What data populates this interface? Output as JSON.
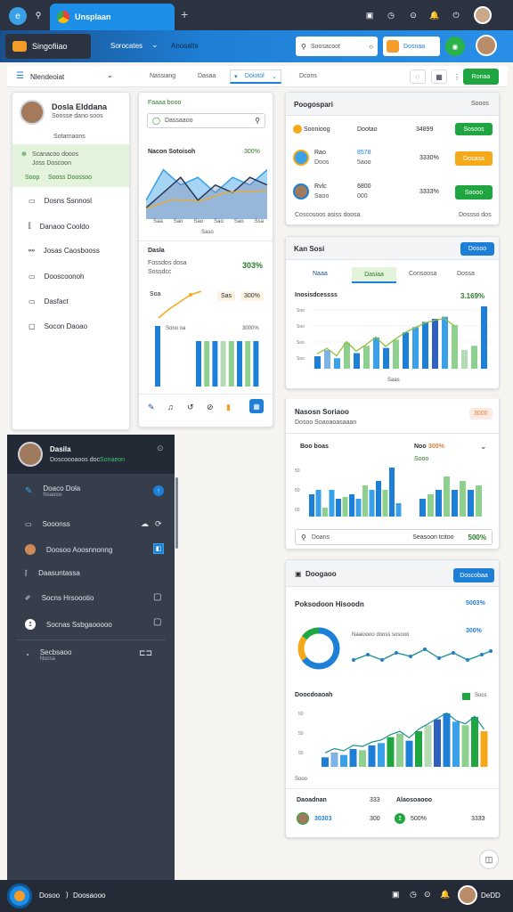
{
  "browser": {
    "tab_title": "Unsplaan",
    "new_tab": "+"
  },
  "appbar": {
    "brand": "Singofiiao",
    "nav1": "Sorocates",
    "nav2": "Anosalts",
    "search_placeholder": "Soosacoot",
    "cta": "Dosnaa"
  },
  "subtoolbar": {
    "menu": "Nlendeoiat",
    "filters": [
      "Nassiang",
      "Dasaa",
      "Doiotol"
    ],
    "right_label": "Dcons",
    "action": "Ronaa"
  },
  "sidebar": {
    "user_name": "Dosla Elddana",
    "user_sub": "Soosse dano soos",
    "section": "Sotarnaons",
    "sel_line1": "Scanacoo dooos",
    "sel_line2": "Joss Doscoon",
    "sel_link_a": "Soop",
    "sel_link_b": "Sooss Doossoo",
    "items": [
      "Dosns Ssnnosl",
      "Danaoo Cooldo",
      "Josas Caosbooss",
      "Dooscoonoh",
      "Dasfact",
      "Socon Daoao"
    ]
  },
  "midcol": {
    "top_label": "Faaaa booo",
    "search_placeholder": "Dassaaoo",
    "chart1": {
      "title": "Nacon Sotoisoh",
      "pct": "300%",
      "ticks": [
        "Saa",
        "Sao",
        "Sao",
        "Sao",
        "Sao",
        "Ssa"
      ],
      "xlabel": "Saso"
    },
    "chart2": {
      "title": "Dasla",
      "sub": "Fossdos dosa",
      "sub2": "Sossdcc",
      "pct": "303%",
      "b1": "Soa",
      "b2": "Sas",
      "b3": "300%"
    },
    "chart3": {
      "legend_left": "Sono oa",
      "legend_right": "3000%"
    }
  },
  "dark": {
    "user_name": "Dasila",
    "user_sub": "Doscoooaoos doc",
    "user_status": "Sonaeon",
    "items": [
      {
        "label": "Doaco Dola",
        "sub": "Nsaooo"
      },
      {
        "label": "Sooonss"
      },
      {
        "label": "Doosoo Aoosnnonng"
      },
      {
        "label": "Daasuntassa"
      },
      {
        "label": "Socns Hrsoootio"
      },
      {
        "label": "Socnas Ssbgaooooo"
      },
      {
        "label": "Secbsaoo",
        "sub": "Nsosa"
      }
    ]
  },
  "panel1": {
    "title": "Poogospari",
    "link": "Sooos",
    "rows": [
      {
        "name": "Soonioog",
        "value": "Dootao",
        "amount": "34899",
        "btn": "Sosoos"
      },
      {
        "name": "Rao",
        "sub": "Doos",
        "value": "8578",
        "sub2": "5aoo",
        "amount": "3330%",
        "btn": "Dosasa"
      },
      {
        "name": "Rvlc",
        "sub": "Saoo",
        "value": "6800",
        "sub2": "000",
        "amount": "3333%",
        "btn": "Soooo"
      }
    ],
    "foot_left": "Coscosoos asiss doosa",
    "foot_right": "Dossso dos"
  },
  "panel2": {
    "title": "Kan Sosi",
    "action": "Dosoo",
    "tabs": [
      "Naaa",
      "Dasiaa",
      "Consoosa",
      "Dossa"
    ],
    "chart_title": "Inosisdcessss",
    "pct": "3.169%",
    "xlabel": "Saas"
  },
  "panel3": {
    "title": "Nasosn Soriaoo",
    "sub": "Dosoo Soaoaoasaaan",
    "badge": "3000",
    "left_label": "Boo boas",
    "right_label": "Noo",
    "right_pct": "300%",
    "right_sub": "Sooo",
    "search_placeholder": "Doans",
    "foot_mid": "Seasoon tcitoo",
    "foot_pct": "500%"
  },
  "panel4": {
    "title": "Doogaoo",
    "action": "Doscobaa",
    "subtitle": "Poksodoon Hisoodn",
    "pct1": "5003%",
    "line_pct": "300%",
    "line_label": "Naaioooo dooss sosooo",
    "bar_title": "Doocdoaoah",
    "bar_legend": "Socs",
    "bar_sub": "Sooo",
    "foot": [
      {
        "name": "Daoadnan",
        "value": "30303",
        "mid": "333"
      },
      {
        "name": "Alaosoaooo",
        "value": "500%",
        "mid": "300"
      }
    ],
    "foot_right": "3333"
  },
  "taskbar": {
    "label": "Dosoo",
    "sub": "Doosaooo",
    "right": "DeDD"
  },
  "chart_data": [
    {
      "type": "area",
      "title": "Nacon Sotoisoh",
      "series": [
        {
          "values": [
            2,
            6,
            4,
            5,
            3,
            5,
            4,
            6
          ]
        },
        {
          "values": [
            1,
            3,
            5,
            2,
            4,
            3,
            5,
            4
          ]
        }
      ]
    },
    {
      "type": "bar",
      "title": "Inosisdcessss",
      "categories": [
        "Saa",
        "Saa",
        "Saa",
        "Saa",
        "Saa",
        "Saa",
        "Saa",
        "Saa",
        "Saa",
        "Saa",
        "Saa",
        "Saa",
        "Saa",
        "Saa",
        "Saa",
        "Saa",
        "Saa",
        "Saa"
      ],
      "series": [
        {
          "values": [
            12,
            18,
            10,
            25,
            15,
            22,
            30,
            20,
            28,
            35,
            40,
            45,
            48,
            50,
            42,
            18,
            22,
            60
          ]
        }
      ],
      "ylim": [
        0,
        60
      ]
    },
    {
      "type": "bar",
      "title": "Nasosn Soriaoo",
      "series": [
        {
          "values": [
            25,
            30,
            10,
            30,
            20,
            22,
            25,
            20,
            35,
            30,
            40,
            30,
            55,
            15
          ]
        },
        {
          "values": [
            20,
            25,
            30,
            45,
            30,
            40,
            30,
            35
          ]
        }
      ]
    },
    {
      "type": "pie",
      "values": [
        65,
        20,
        15
      ]
    },
    {
      "type": "bar",
      "title": "Doocdoaoah",
      "series": [
        {
          "values": [
            8,
            12,
            10,
            15,
            14,
            18,
            20,
            25,
            28,
            22,
            30,
            35,
            40,
            45,
            38,
            35,
            42,
            30
          ]
        }
      ]
    }
  ]
}
